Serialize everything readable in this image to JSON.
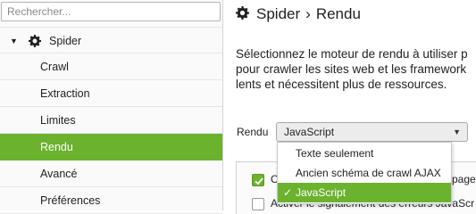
{
  "search": {
    "placeholder": "Rechercher..."
  },
  "sidebar": {
    "parent": {
      "label": "Spider",
      "icon": "gear-icon",
      "expanded": true
    },
    "items": [
      {
        "label": "Crawl",
        "selected": false
      },
      {
        "label": "Extraction",
        "selected": false
      },
      {
        "label": "Limites",
        "selected": false
      },
      {
        "label": "Rendu",
        "selected": true
      },
      {
        "label": "Avancé",
        "selected": false
      },
      {
        "label": "Préférences",
        "selected": false
      }
    ]
  },
  "header": {
    "section": "Spider",
    "separator": "›",
    "page": "Rendu"
  },
  "description": {
    "line1": "Sélectionnez le moteur de rendu à utiliser p",
    "line2": "pour crawler les sites web et les framework",
    "line3": "lents et nécessitent plus de ressources."
  },
  "rendering": {
    "label": "Rendu",
    "selected_value": "JavaScript",
    "options": [
      {
        "label": "Texte seulement",
        "selected": false
      },
      {
        "label": "Ancien schéma de crawl AJAX",
        "selected": false
      },
      {
        "label": "JavaScript",
        "selected": true
      }
    ],
    "check_mark": "✓"
  },
  "options_panel": {
    "checkbox1": {
      "label_prefix": "C",
      "label_tail": "page r",
      "checked": true
    },
    "checkbox2": {
      "label": "Activer le signalement des erreurs JavaScr",
      "checked": false
    }
  },
  "colors": {
    "accent": "#6bb22e",
    "text": "#222222",
    "border": "#cfcfcf"
  }
}
